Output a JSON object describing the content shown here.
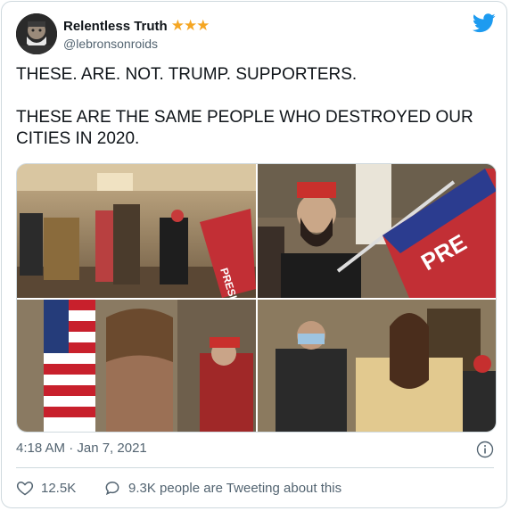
{
  "tweet": {
    "author": {
      "display_name": "Relentless Truth",
      "badge": "★★★",
      "handle": "@lebronsonroids"
    },
    "text_line1": "THESE. ARE. NOT. TRUMP. SUPPORTERS.",
    "text_line2": "THESE ARE THE SAME PEOPLE WHO DESTROYED OUR CITIES IN 2020.",
    "images": [
      {
        "flag_text": "PRESIDEN"
      },
      {
        "flag_text": "PRE"
      },
      {},
      {}
    ],
    "timestamp": "4:18 AM · Jan 7, 2021",
    "likes": "12.5K",
    "conversation": "9.3K people are Tweeting about this"
  },
  "colors": {
    "accent": "#1d9bf0",
    "text_secondary": "#536471",
    "star": "#f5a623",
    "border": "#cfd9de"
  },
  "icons": [
    "twitter-bird-icon",
    "info-icon",
    "heart-icon",
    "comment-icon"
  ]
}
